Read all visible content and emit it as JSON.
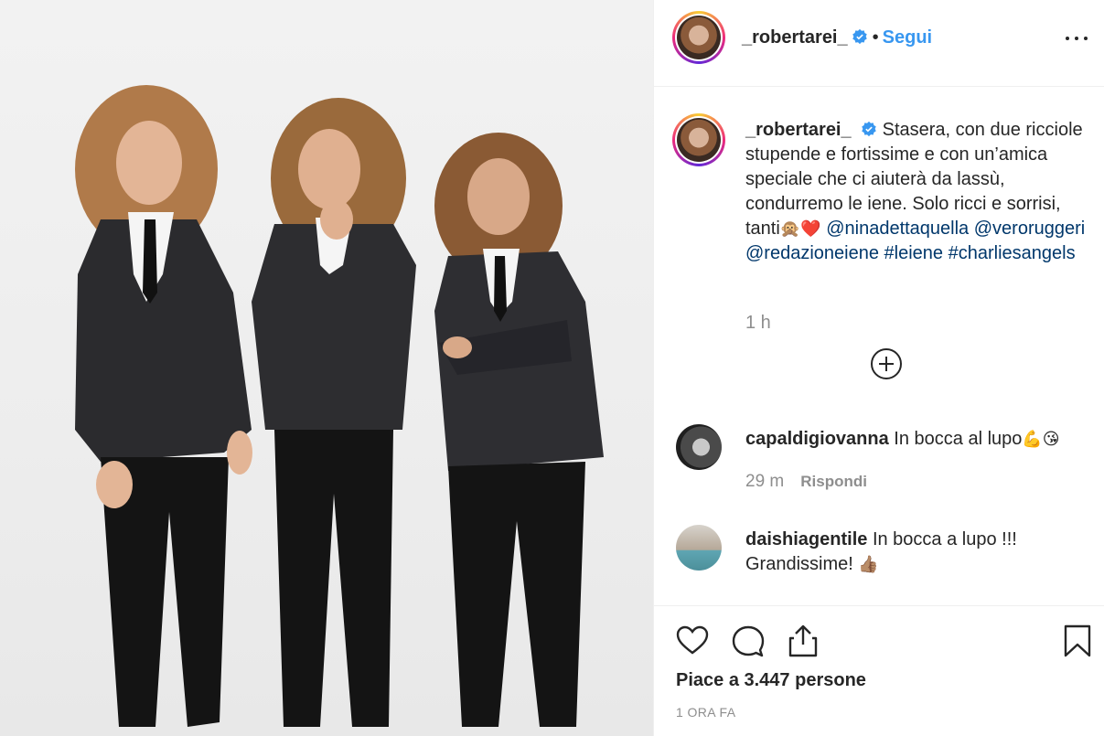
{
  "post": {
    "username": "_robertarei_",
    "follow_label": "Segui",
    "separator": "•",
    "caption_text": "Stasera, con due ricciole stupende e fortissime e con un’amica speciale che ci aiuterà da lassù, condurremo le iene. Solo ricci e sorrisi, tanti",
    "caption_emojis": "🙊❤️",
    "caption_mentions": [
      "@ninadettaquella",
      "@veroruggeri",
      "@redazioneiene"
    ],
    "caption_hashtags": [
      "#leiene",
      "#charliesangels"
    ],
    "caption_time": "1 h"
  },
  "comments": [
    {
      "username": "capaldigiovanna",
      "text": "In bocca al lupo",
      "emojis": "💪😘",
      "time": "29 m",
      "reply_label": "Rispondi"
    },
    {
      "username": "daishiagentile",
      "text": "In bocca a lupo !!! Grandissime!",
      "emojis": "👍🏽"
    }
  ],
  "footer": {
    "likes": "Piace a 3.447 persone",
    "timestamp": "1 ORA FA"
  },
  "icons": {
    "more": "more-options-icon",
    "verified": "verified-badge-icon",
    "load_more": "plus-circle-icon",
    "like": "heart-icon",
    "comment": "comment-icon",
    "share": "share-icon",
    "save": "bookmark-icon"
  },
  "colors": {
    "link": "#00376b",
    "follow": "#3897f0",
    "verified": "#3897f0",
    "muted": "#8e8e8e",
    "text": "#262626"
  }
}
